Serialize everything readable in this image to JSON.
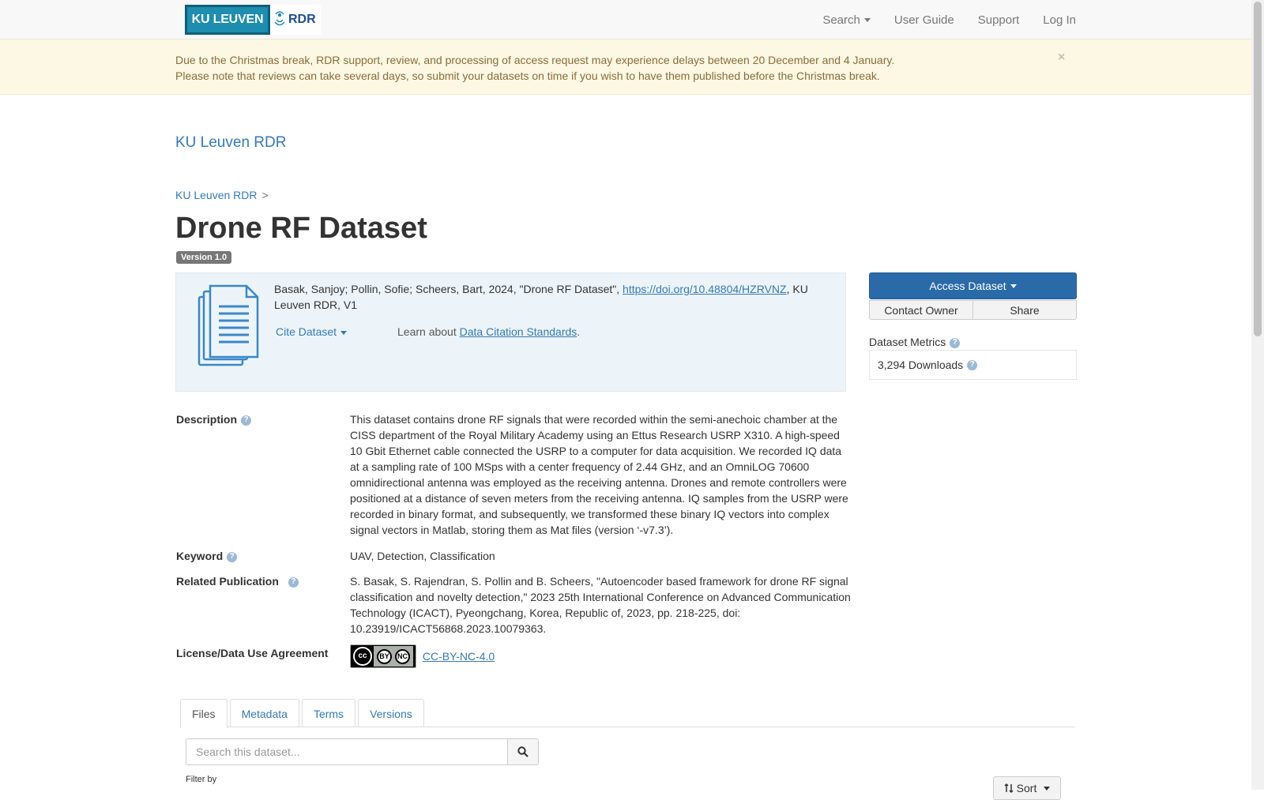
{
  "navbar": {
    "logo_left": "KU LEUVEN",
    "logo_right": "RDR",
    "links": {
      "search": "Search",
      "user_guide": "User Guide",
      "support": "Support",
      "login": "Log In"
    }
  },
  "alert": {
    "line1": "Due to the Christmas break, RDR support, review, and processing of access request may experience delays between 20 December and 4 January.",
    "line2": "Please note that reviews can take several days, so submit your datasets on time if you wish to have them published before the Christmas break.",
    "close": "×"
  },
  "site_title": "KU Leuven RDR",
  "breadcrumb": {
    "root": "KU Leuven RDR",
    "sep": ">"
  },
  "dataset": {
    "title": "Drone RF Dataset",
    "version": "Version 1.0"
  },
  "citation": {
    "text_before": "Basak, Sanjoy; Pollin, Sofie; Scheers, Bart, 2024, \"Drone RF Dataset\", ",
    "doi": "https://doi.org/10.48804/HZRVNZ",
    "text_after": ", KU Leuven RDR, V1",
    "cite_button": "Cite Dataset",
    "learn_prefix": "Learn about ",
    "learn_link": "Data Citation Standards",
    "learn_suffix": "."
  },
  "sidebar": {
    "access": "Access Dataset",
    "contact": "Contact Owner",
    "share": "Share",
    "metrics_title": "Dataset Metrics",
    "downloads": "3,294 Downloads"
  },
  "metadata": {
    "description_label": "Description",
    "description": "This dataset contains drone RF signals that were recorded within the semi-anechoic chamber at the CISS department of the Royal Military Academy using an Ettus Research USRP X310. A high-speed 10 Gbit Ethernet cable connected the USRP to a computer for data acquisition. We recorded IQ data at a sampling rate of 100 MSps with a center frequency of 2.44 GHz, and an OmniLOG 70600 omnidirectional antenna was employed as the receiving antenna. Drones and remote controllers were positioned at a distance of seven meters from the receiving antenna. IQ samples from the USRP were recorded in binary format, and subsequently, we transformed these binary IQ vectors into complex signal vectors in Matlab, storing them as Mat files (version ‘-v7.3’).",
    "keyword_label": "Keyword",
    "keyword": "UAV, Detection, Classification",
    "related_label": "Related Publication",
    "related": "S. Basak, S. Rajendran, S. Pollin and B. Scheers, \"Autoencoder based framework for drone RF signal classification and novelty detection,\" 2023 25th International Conference on Advanced Communication Technology (ICACT), Pyeongchang, Korea, Republic of, 2023, pp. 218-225, doi: 10.23919/ICACT56868.2023.10079363.",
    "license_label": "License/Data Use Agreement",
    "license": "CC-BY-NC-4.0",
    "license_badge": {
      "cc": "cc",
      "by": "BY",
      "nc": "NC"
    }
  },
  "tabs": [
    "Files",
    "Metadata",
    "Terms",
    "Versions"
  ],
  "files": {
    "search_placeholder": "Search this dataset...",
    "filter_label": "Filter by",
    "sort": "Sort"
  },
  "colors": {
    "primary": "#337ab7",
    "access_button": "#2a6aa8",
    "alert_bg": "#fcf8e3",
    "cite_bg": "#edf4f9"
  }
}
